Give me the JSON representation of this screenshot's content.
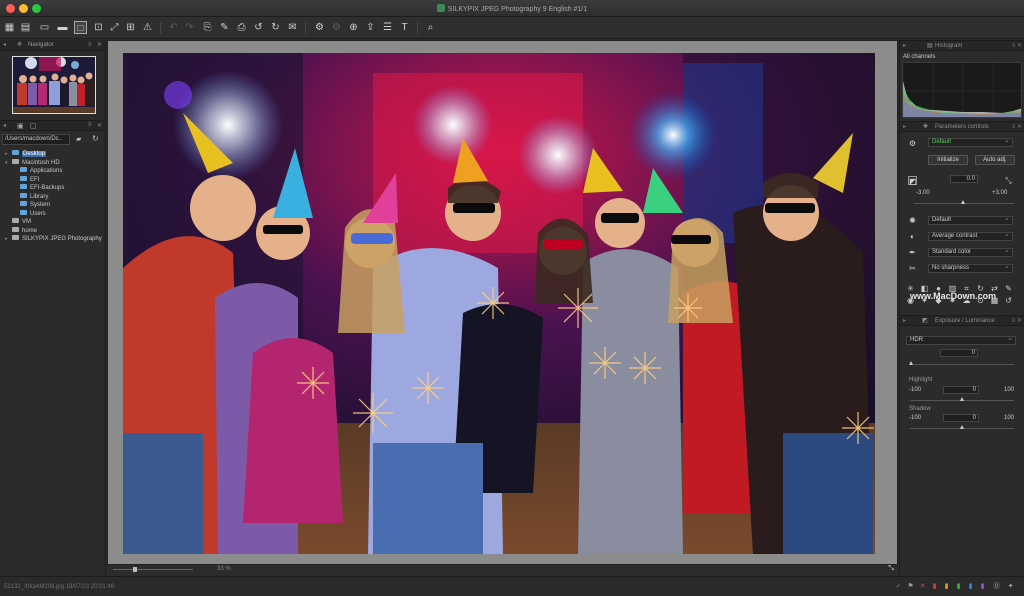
{
  "window": {
    "title": "SILKYPIX JPEG Photography 9 English   #1/1",
    "traffic_colors": [
      "#fe5f57",
      "#febc2e",
      "#28c840"
    ]
  },
  "left_panel": {
    "navigator_title": "Navigator",
    "path": "/Users/macdown/Dc..",
    "tree": [
      {
        "label": "Desktop",
        "selected": true,
        "indent": 1
      },
      {
        "label": "Macintosh HD",
        "indent": 1
      },
      {
        "label": "Applications",
        "indent": 2
      },
      {
        "label": "EFI",
        "indent": 2
      },
      {
        "label": "EFI-Backups",
        "indent": 2
      },
      {
        "label": "Library",
        "indent": 2
      },
      {
        "label": "System",
        "indent": 2
      },
      {
        "label": "Users",
        "indent": 2
      },
      {
        "label": "VM",
        "indent": 1
      },
      {
        "label": "home",
        "indent": 1
      },
      {
        "label": "SILKYPIX JPEG Photography",
        "indent": 1
      }
    ]
  },
  "center": {
    "zoom": "33 %"
  },
  "right_panel": {
    "histogram_title": "Histogram",
    "channel": "All channels",
    "params_title": "Parameters controls",
    "preset": "Default",
    "initialize_label": "Initialize",
    "auto_adj_label": "Auto adj.",
    "exposure_value": "0.0",
    "exposure_min": "-3.00",
    "exposure_max": "+3.00",
    "wb": "Default",
    "contrast": "Average contrast",
    "color": "Standard color",
    "sharpness": "No sharpness",
    "exposure_title": "Exposure / Luminance",
    "hdr_label": "HDR",
    "hdr_value": "0",
    "highlight_label": "Highlight",
    "highlight_min": "-100",
    "highlight_value": "0",
    "highlight_max": "100",
    "shadow_label": "Shadow",
    "shadow_min": "-100",
    "shadow_value": "0",
    "shadow_max": "100",
    "watermark": "www.MacDown.com"
  },
  "statusbar": {
    "file_info": "52132_Xtka4M208.jpg 19/07/23 20:01:48"
  }
}
